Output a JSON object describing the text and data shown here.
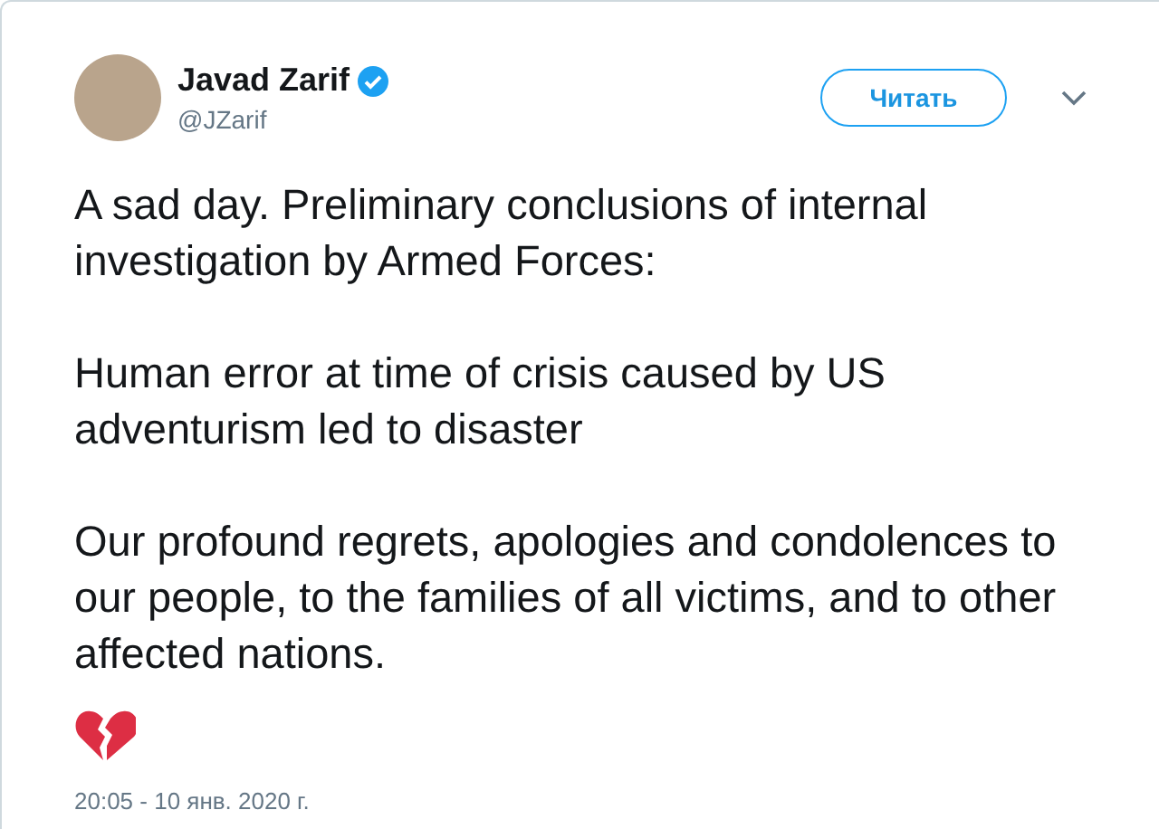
{
  "author": {
    "name": "Javad Zarif",
    "handle": "@JZarif",
    "verified": true
  },
  "follow_button": "Читать",
  "paragraphs": [
    "A sad day. Preliminary conclusions of internal investigation by Armed Forces:",
    "Human error at time of crisis caused by US adventurism led to disaster",
    "Our profound regrets, apologies and condolences to our people, to the families of all victims, and to other affected nations."
  ],
  "timestamp": "20:05 - 10 янв. 2020 г."
}
